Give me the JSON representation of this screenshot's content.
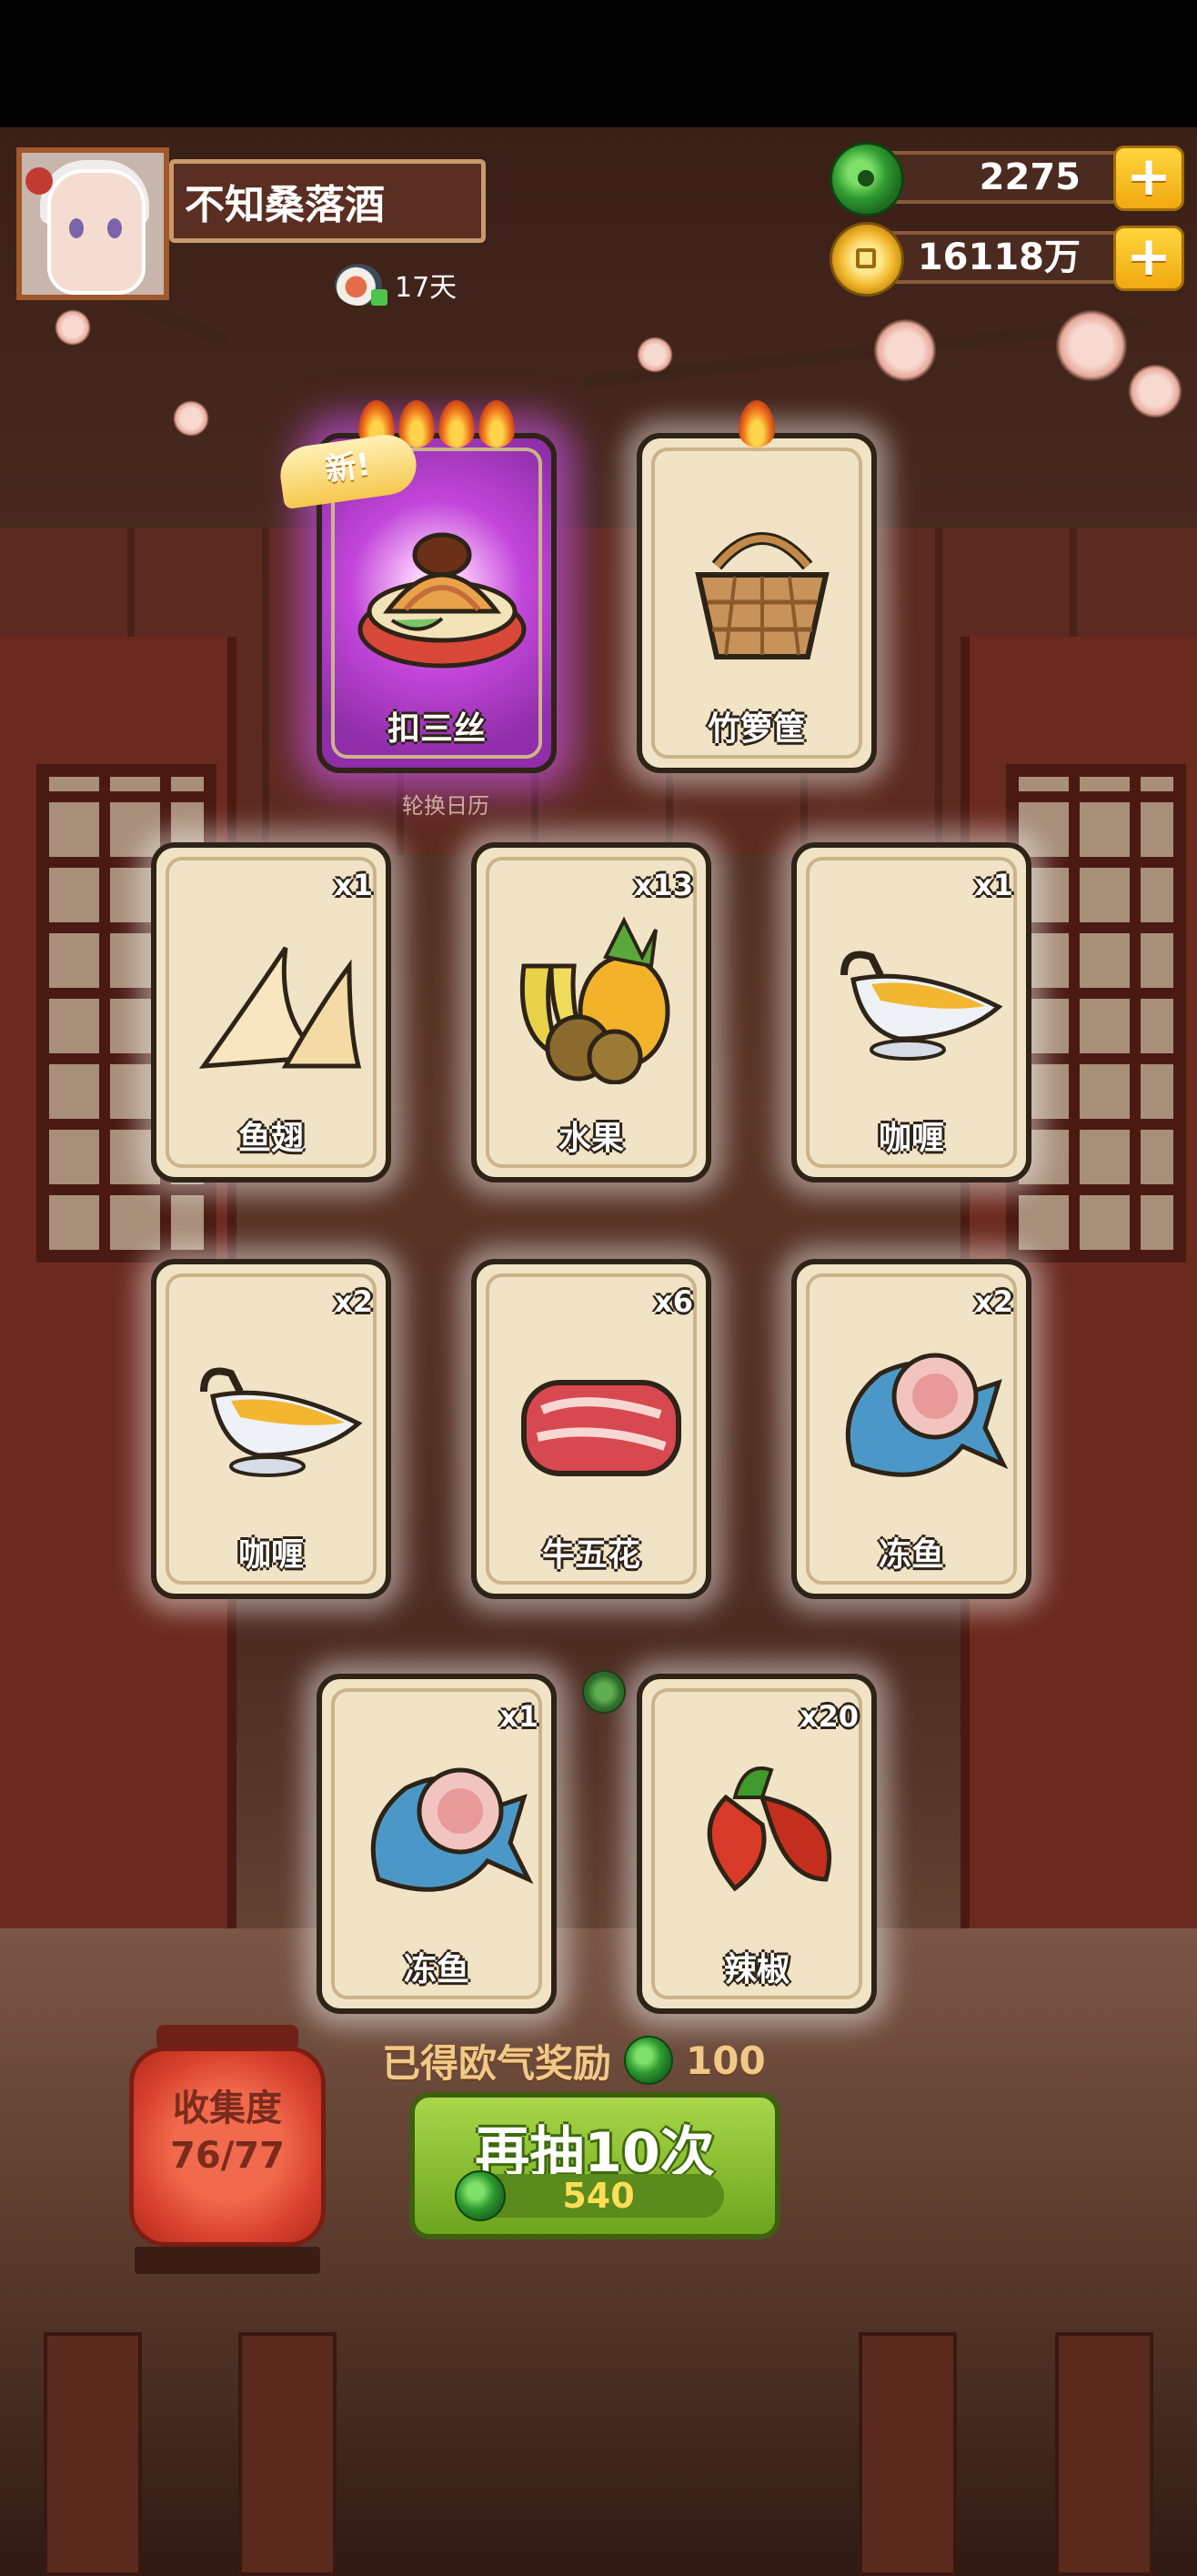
{
  "player": {
    "name": "不知桑落酒",
    "days": "17天"
  },
  "currency": {
    "jade": "2275",
    "coins": "16118万"
  },
  "badges": {
    "new": "新!"
  },
  "calendar_label": "轮换日历",
  "cards": [
    {
      "label": "扣三丝",
      "count": "",
      "flames": 4,
      "rare": true,
      "icon": "dish-icon"
    },
    {
      "label": "竹箩筐",
      "count": "",
      "flames": 1,
      "rare": false,
      "icon": "basket-icon"
    },
    {
      "label": "鱼翅",
      "count": "x1",
      "icon": "fin-icon"
    },
    {
      "label": "水果",
      "count": "x13",
      "icon": "fruit-icon"
    },
    {
      "label": "咖喱",
      "count": "x1",
      "icon": "curry-icon"
    },
    {
      "label": "咖喱",
      "count": "x2",
      "icon": "curry-icon"
    },
    {
      "label": "牛五花",
      "count": "x6",
      "icon": "beef-icon"
    },
    {
      "label": "冻鱼",
      "count": "x2",
      "icon": "fish-icon"
    },
    {
      "label": "冻鱼",
      "count": "x1",
      "icon": "fish-icon"
    },
    {
      "label": "辣椒",
      "count": "x20",
      "icon": "chili-icon"
    }
  ],
  "reward": {
    "label": "已得欧气奖励",
    "amount": "100"
  },
  "draw_button": {
    "label": "再抽10次",
    "cost": "540"
  },
  "collection": {
    "label": "收集度",
    "progress": "76/77"
  }
}
